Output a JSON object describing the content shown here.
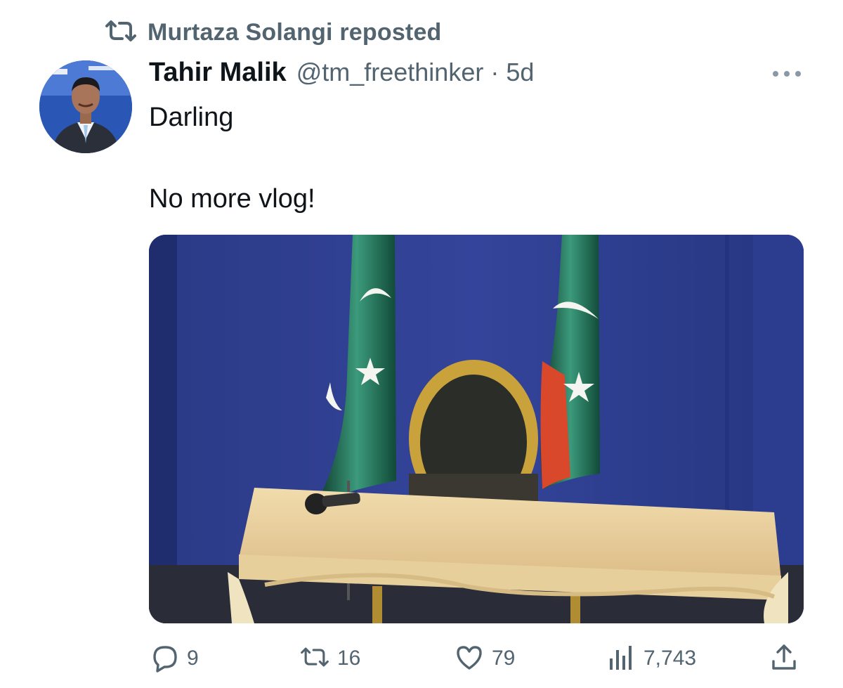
{
  "repost_banner": {
    "icon": "repost-icon",
    "text": "Murtaza Solangi reposted"
  },
  "author": {
    "name": "Tahir Malik",
    "handle": "@tm_freethinker",
    "separator": "·",
    "age": "5d",
    "avatar_icon": "avatar-photo"
  },
  "post": {
    "line1": "Darling",
    "line2": "No more vlog!",
    "media_description_icon": "photo-empty-chair-with-flags"
  },
  "more_icon": "more-dots-icon",
  "actions": {
    "reply": {
      "icon": "reply-icon",
      "count": "9"
    },
    "repost": {
      "icon": "repost-icon",
      "count": "16"
    },
    "like": {
      "icon": "heart-icon",
      "count": "79"
    },
    "views": {
      "icon": "views-chart-icon",
      "count": "7,743"
    },
    "share": {
      "icon": "share-icon"
    }
  },
  "colors": {
    "text_primary": "#0f1419",
    "text_secondary": "#536471",
    "backdrop_blue": "#2a3a84",
    "flag_green": "#1e6b54",
    "desk_wood": "#e8cf9f"
  }
}
